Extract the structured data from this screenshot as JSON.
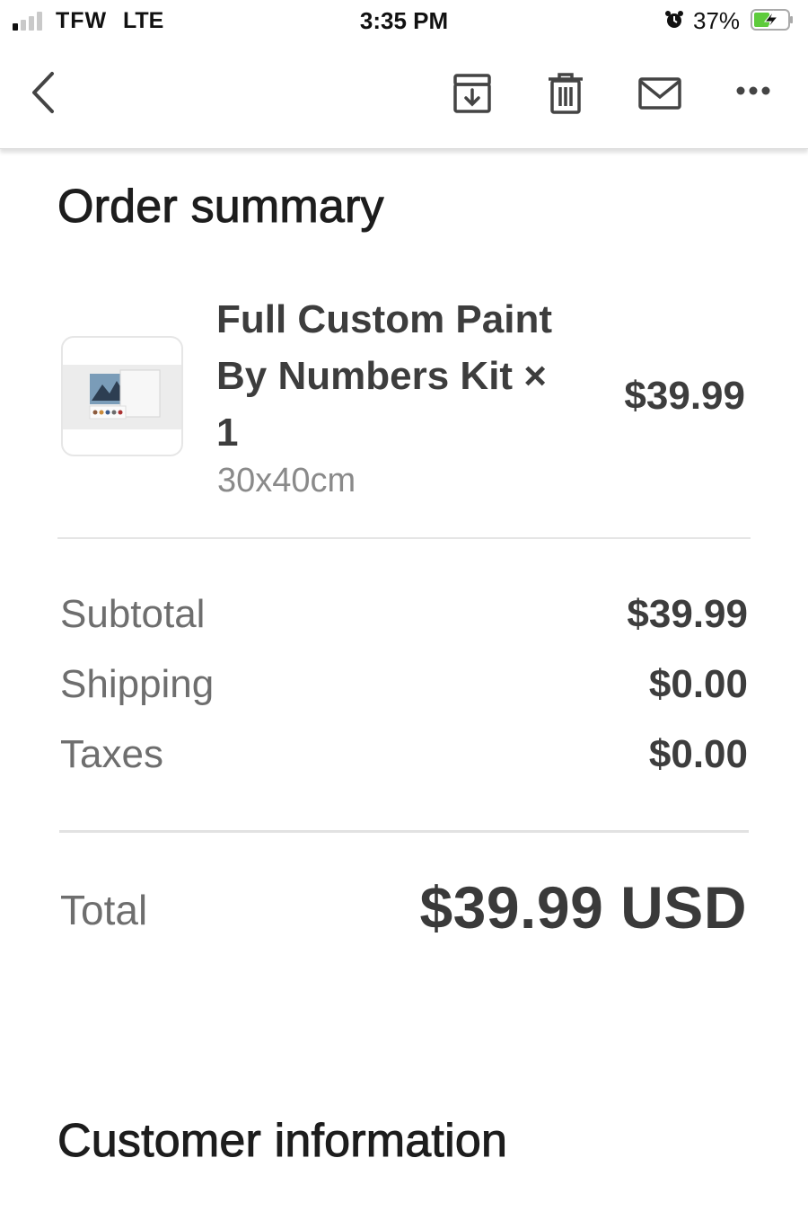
{
  "status_bar": {
    "carrier": "TFW",
    "network": "LTE",
    "time": "3:35 PM",
    "battery_percent": "37%",
    "signal_bars_active": 1,
    "signal_bars_total": 4
  },
  "toolbar": {
    "back_icon": "chevron-left-icon",
    "actions": [
      "archive-icon",
      "trash-icon",
      "mail-icon",
      "more-icon"
    ]
  },
  "order_summary": {
    "title": "Order summary",
    "item": {
      "name": "Full Custom Paint By Numbers Kit × 1",
      "variant": "30x40cm",
      "price": "$39.99"
    },
    "subtotal": {
      "label": "Subtotal",
      "value": "$39.99"
    },
    "shipping": {
      "label": "Shipping",
      "value": "$0.00"
    },
    "taxes": {
      "label": "Taxes",
      "value": "$0.00"
    },
    "total": {
      "label": "Total",
      "value": "$39.99 USD"
    }
  },
  "customer_information": {
    "title": "Customer information"
  },
  "colors": {
    "battery_green": "#5ecb3c",
    "text_dark": "#3d3d3d",
    "text_muted": "#6e6e6e"
  }
}
